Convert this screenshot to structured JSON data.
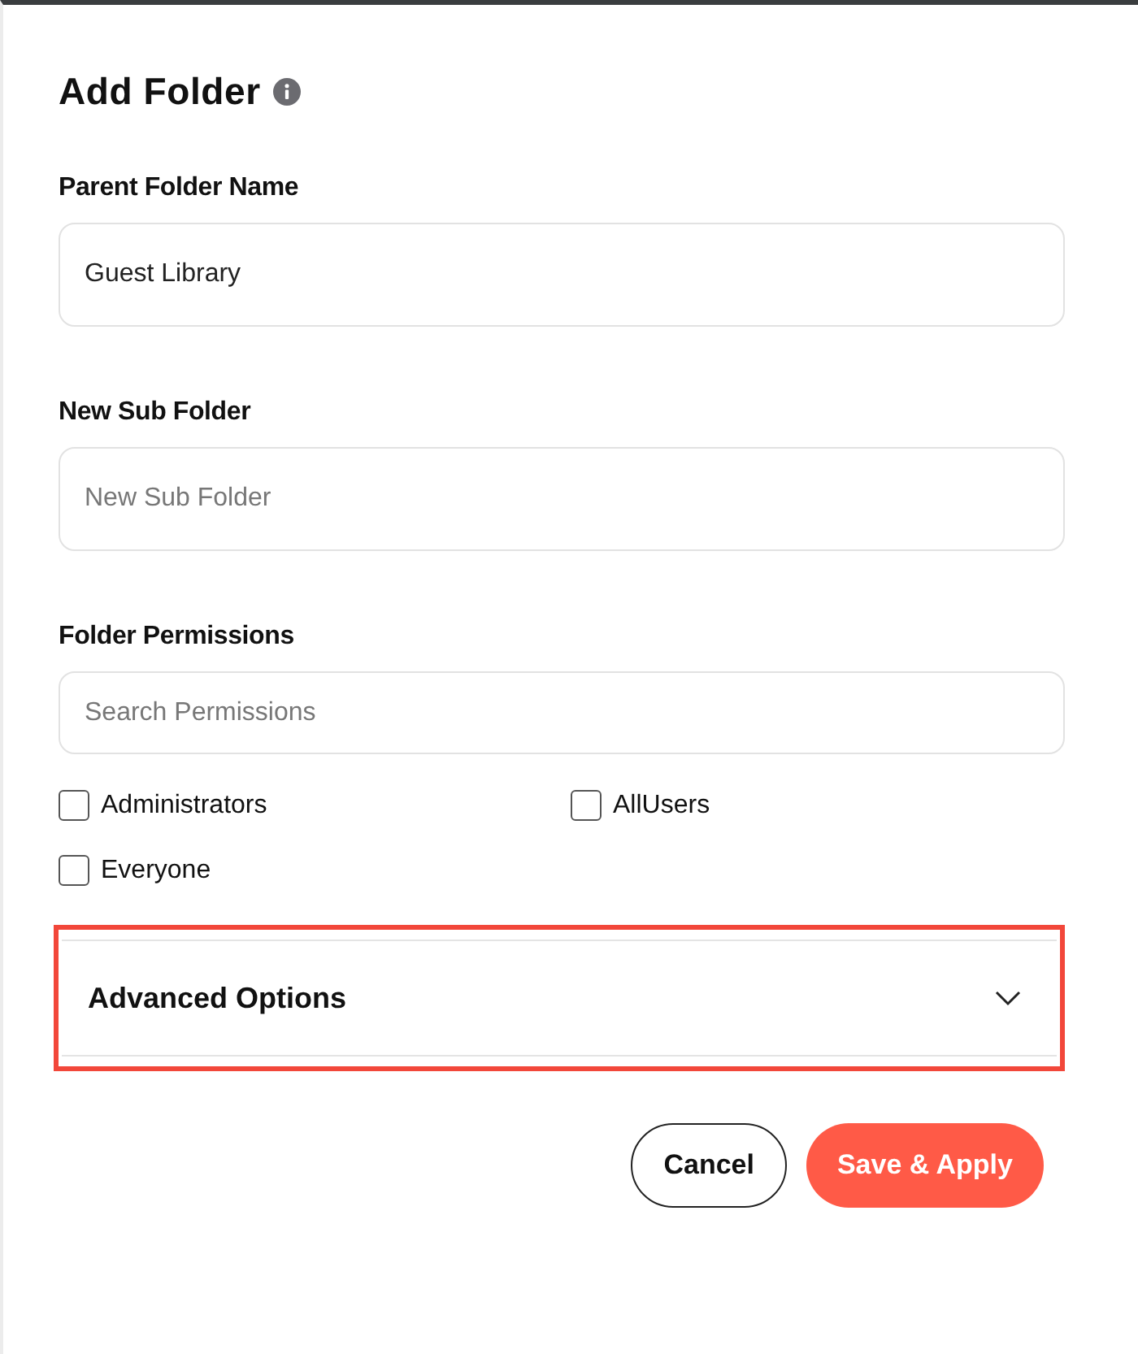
{
  "title": "Add Folder",
  "fields": [
    {
      "label": "Parent Folder Name",
      "value": "Guest Library"
    },
    {
      "label": "New Sub Folder",
      "placeholder": "New Sub Folder"
    }
  ],
  "permissions": {
    "label": "Folder Permissions",
    "search": {
      "placeholder": "Search Permissions"
    },
    "options": [
      {
        "label": "Administrators",
        "checked": false
      },
      {
        "label": "AllUsers",
        "checked": false
      },
      {
        "label": "Everyone",
        "checked": false
      }
    ]
  },
  "advanced": {
    "label": "Advanced Options",
    "expanded": false,
    "highlighted": true
  },
  "buttons": [
    {
      "label": "Cancel",
      "kind": "secondary"
    },
    {
      "label": "Save & Apply",
      "kind": "primary"
    }
  ]
}
